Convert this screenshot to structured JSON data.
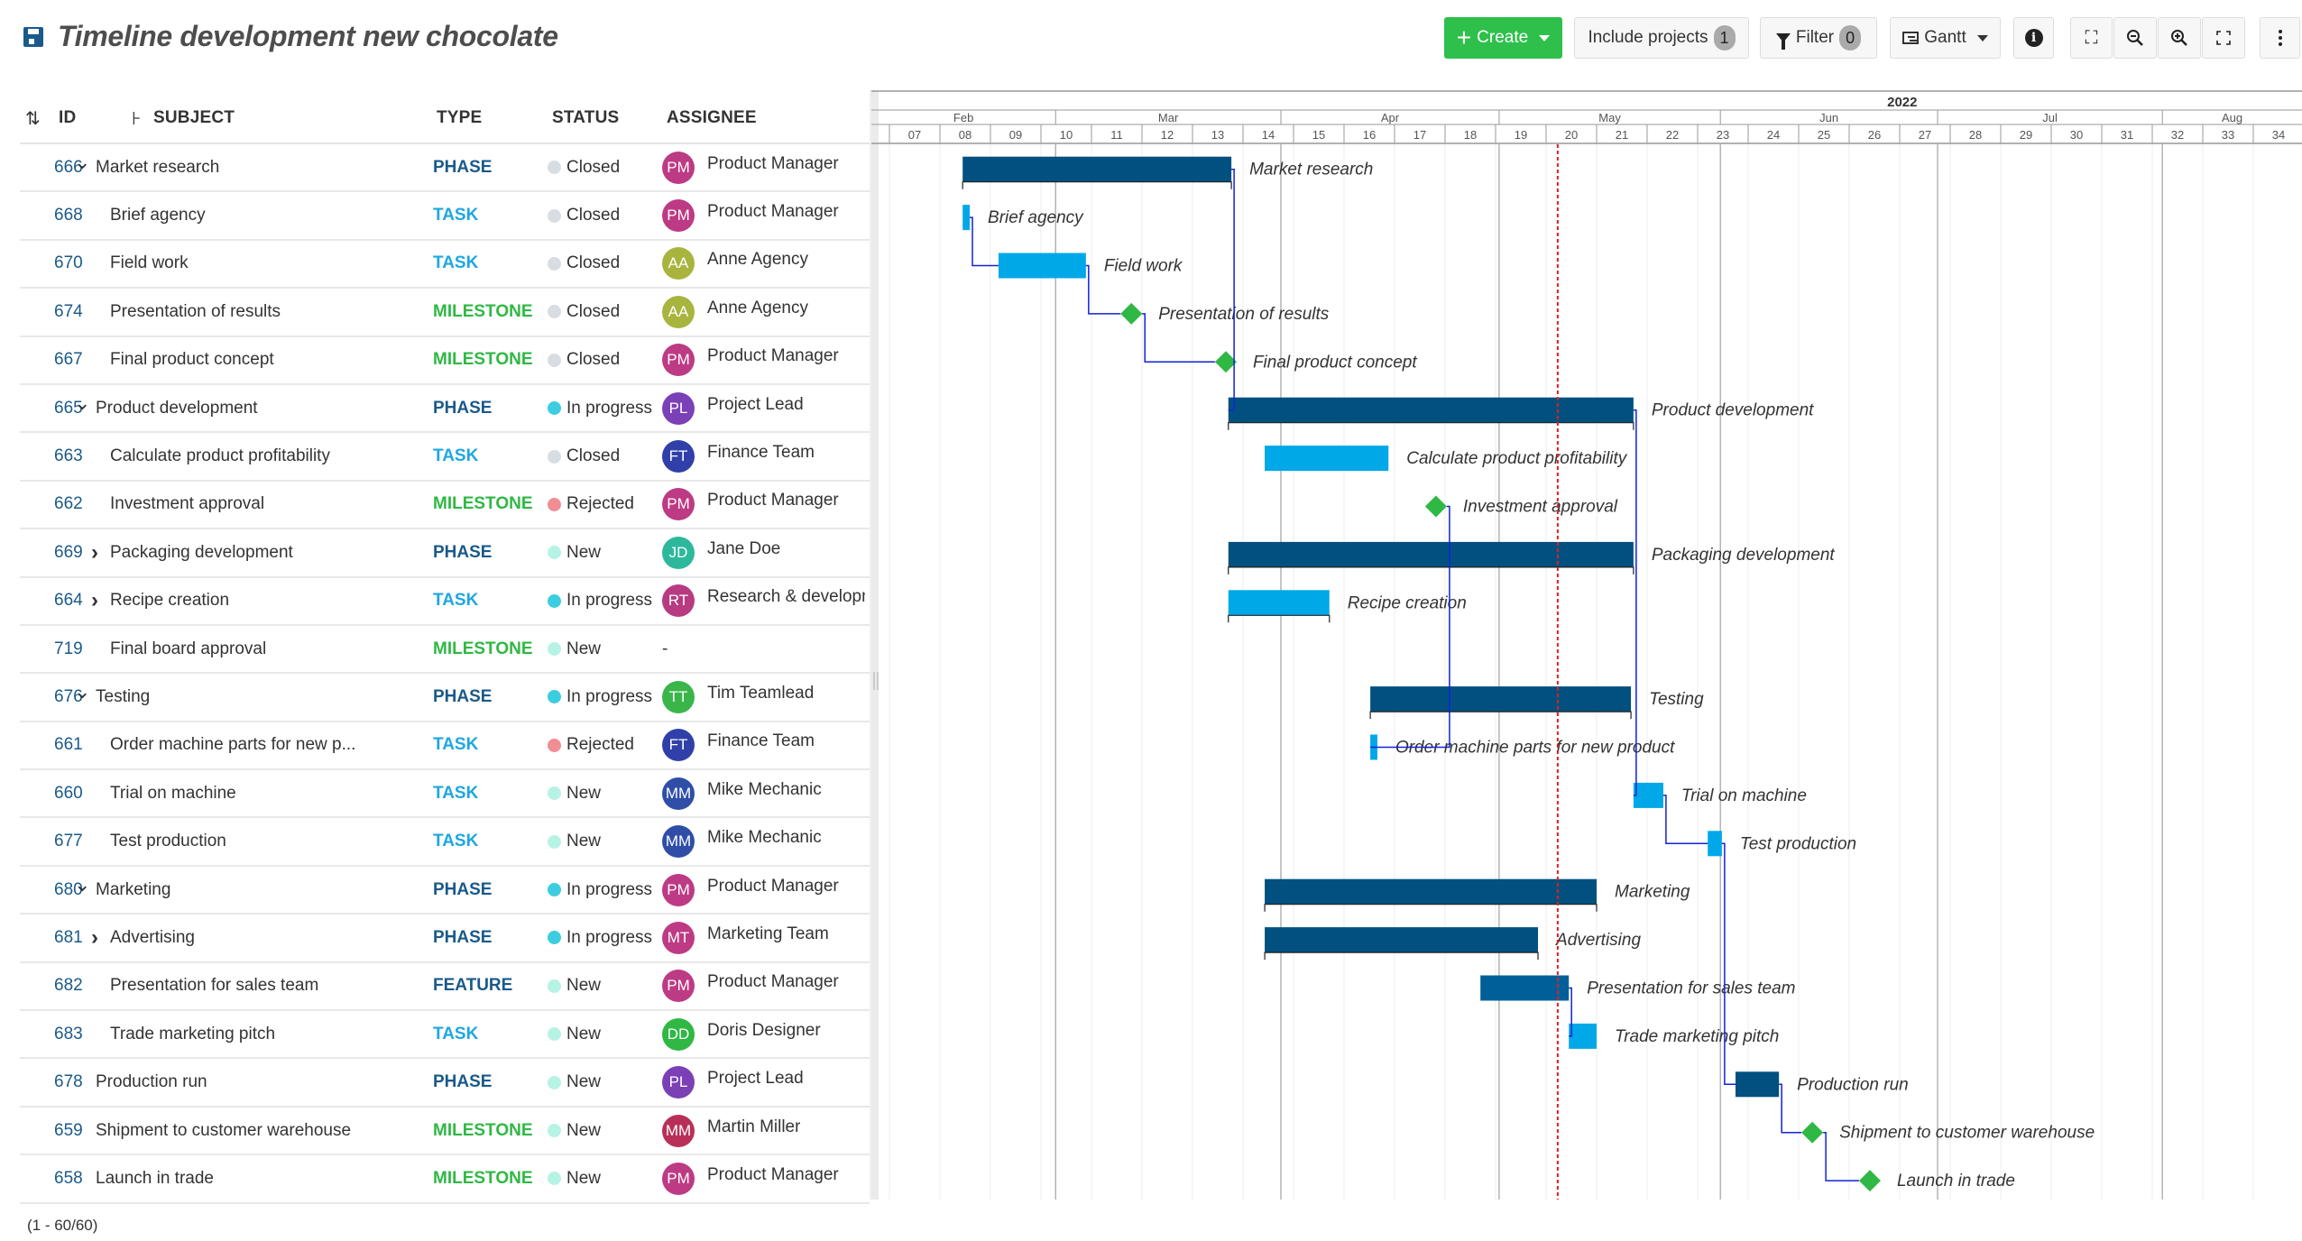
{
  "header": {
    "title": "Timeline development new chocolate",
    "save_icon": "floppy-disk-icon"
  },
  "toolbar": {
    "create_label": "Create",
    "include_projects_label": "Include projects",
    "include_projects_count": "1",
    "filter_label": "Filter",
    "filter_count": "0",
    "view_label": "Gantt",
    "icons": [
      "plus-icon",
      "caret-down-icon",
      "filter-icon",
      "gantt-icon",
      "info-icon",
      "zoom-auto-icon",
      "zoom-out-icon",
      "zoom-in-icon",
      "fullscreen-icon",
      "more-vertical-icon"
    ]
  },
  "table": {
    "columns": {
      "id": "ID",
      "subject": "SUBJECT",
      "type": "TYPE",
      "status": "STATUS",
      "assignee": "ASSIGNEE"
    },
    "footer": "(1 - 60/60)",
    "type_colors": {
      "PHASE": "#1a5a8a",
      "TASK": "#1ea7e1",
      "MILESTONE": "#2fb844",
      "FEATURE": "#1a5a8a"
    },
    "status_colors": {
      "Closed": "#d8dde2",
      "In progress": "#3dcde0",
      "Rejected": "#f08e94",
      "New": "#b6f3e4"
    },
    "rows": [
      {
        "id": "666",
        "subject": "Market research",
        "level": 0,
        "expander": "expanded",
        "type": "PHASE",
        "status": "Closed",
        "initials": "PM",
        "assignee": "Product Manager",
        "avatar_color": "#bd3a84"
      },
      {
        "id": "668",
        "subject": "Brief agency",
        "level": 1,
        "expander": "",
        "type": "TASK",
        "status": "Closed",
        "initials": "PM",
        "assignee": "Product Manager",
        "avatar_color": "#bd3a84"
      },
      {
        "id": "670",
        "subject": "Field work",
        "level": 1,
        "expander": "",
        "type": "TASK",
        "status": "Closed",
        "initials": "AA",
        "assignee": "Anne Agency",
        "avatar_color": "#a9b43e"
      },
      {
        "id": "674",
        "subject": "Presentation of results",
        "level": 1,
        "expander": "",
        "type": "MILESTONE",
        "status": "Closed",
        "initials": "AA",
        "assignee": "Anne Agency",
        "avatar_color": "#a9b43e"
      },
      {
        "id": "667",
        "subject": "Final product concept",
        "level": 1,
        "expander": "",
        "type": "MILESTONE",
        "status": "Closed",
        "initials": "PM",
        "assignee": "Product Manager",
        "avatar_color": "#bd3a84"
      },
      {
        "id": "665",
        "subject": "Product development",
        "level": 0,
        "expander": "expanded",
        "type": "PHASE",
        "status": "In progress",
        "initials": "PL",
        "assignee": "Project Lead",
        "avatar_color": "#7b3fb6"
      },
      {
        "id": "663",
        "subject": "Calculate product profitability",
        "level": 1,
        "expander": "",
        "type": "TASK",
        "status": "Closed",
        "initials": "FT",
        "assignee": "Finance Team",
        "avatar_color": "#3040a8"
      },
      {
        "id": "662",
        "subject": "Investment approval",
        "level": 1,
        "expander": "",
        "type": "MILESTONE",
        "status": "Rejected",
        "initials": "PM",
        "assignee": "Product Manager",
        "avatar_color": "#bd3a84"
      },
      {
        "id": "669",
        "subject": "Packaging development",
        "level": 1,
        "expander": "collapsed",
        "type": "PHASE",
        "status": "New",
        "initials": "JD",
        "assignee": "Jane Doe",
        "avatar_color": "#2db89c"
      },
      {
        "id": "664",
        "subject": "Recipe creation",
        "level": 1,
        "expander": "collapsed",
        "type": "TASK",
        "status": "In progress",
        "initials": "RT",
        "assignee": "Research & developm",
        "avatar_color": "#b83a80"
      },
      {
        "id": "719",
        "subject": "Final board approval",
        "level": 1,
        "expander": "",
        "type": "MILESTONE",
        "status": "New",
        "initials": "",
        "assignee": "-",
        "avatar_color": ""
      },
      {
        "id": "676",
        "subject": "Testing",
        "level": 0,
        "expander": "expanded",
        "type": "PHASE",
        "status": "In progress",
        "initials": "TT",
        "assignee": "Tim Teamlead",
        "avatar_color": "#39b54a"
      },
      {
        "id": "661",
        "subject": "Order machine parts for new p...",
        "level": 1,
        "expander": "",
        "type": "TASK",
        "status": "Rejected",
        "initials": "FT",
        "assignee": "Finance Team",
        "avatar_color": "#3040a8"
      },
      {
        "id": "660",
        "subject": "Trial on machine",
        "level": 1,
        "expander": "",
        "type": "TASK",
        "status": "New",
        "initials": "MM",
        "assignee": "Mike Mechanic",
        "avatar_color": "#2f4ea8"
      },
      {
        "id": "677",
        "subject": "Test production",
        "level": 1,
        "expander": "",
        "type": "TASK",
        "status": "New",
        "initials": "MM",
        "assignee": "Mike Mechanic",
        "avatar_color": "#2f4ea8"
      },
      {
        "id": "680",
        "subject": "Marketing",
        "level": 0,
        "expander": "expanded",
        "type": "PHASE",
        "status": "In progress",
        "initials": "PM",
        "assignee": "Product Manager",
        "avatar_color": "#bd3a84"
      },
      {
        "id": "681",
        "subject": "Advertising",
        "level": 1,
        "expander": "collapsed",
        "type": "PHASE",
        "status": "In progress",
        "initials": "MT",
        "assignee": "Marketing Team",
        "avatar_color": "#bd3a84"
      },
      {
        "id": "682",
        "subject": "Presentation for sales team",
        "level": 1,
        "expander": "",
        "type": "FEATURE",
        "status": "New",
        "initials": "PM",
        "assignee": "Product Manager",
        "avatar_color": "#bd3a84"
      },
      {
        "id": "683",
        "subject": "Trade marketing pitch",
        "level": 1,
        "expander": "",
        "type": "TASK",
        "status": "New",
        "initials": "DD",
        "assignee": "Doris Designer",
        "avatar_color": "#2fb844"
      },
      {
        "id": "678",
        "subject": "Production run",
        "level": 0,
        "expander": "",
        "type": "PHASE",
        "status": "New",
        "initials": "PL",
        "assignee": "Project Lead",
        "avatar_color": "#7b3fb6"
      },
      {
        "id": "659",
        "subject": "Shipment to customer warehouse",
        "level": 0,
        "expander": "",
        "type": "MILESTONE",
        "status": "New",
        "initials": "MM",
        "assignee": "Martin Miller",
        "avatar_color": "#b83058"
      },
      {
        "id": "658",
        "subject": "Launch in trade",
        "level": 0,
        "expander": "",
        "type": "MILESTONE",
        "status": "New",
        "initials": "PM",
        "assignee": "Product Manager",
        "avatar_color": "#bd3a84"
      }
    ]
  },
  "gantt": {
    "year": "2022",
    "weeks": [
      "07",
      "08",
      "09",
      "10",
      "11",
      "12",
      "13",
      "14",
      "15",
      "16",
      "17",
      "18",
      "19",
      "20",
      "21",
      "22",
      "23",
      "24",
      "25",
      "26",
      "27",
      "28",
      "29",
      "30",
      "31",
      "32",
      "33",
      "34"
    ],
    "months": [
      {
        "label": "Feb",
        "start": 6.3,
        "end": 10.29
      },
      {
        "label": "Mar",
        "start": 10.29,
        "end": 14.75
      },
      {
        "label": "Apr",
        "start": 14.75,
        "end": 19.07
      },
      {
        "label": "May",
        "start": 19.07,
        "end": 23.45
      },
      {
        "label": "Jun",
        "start": 23.45,
        "end": 27.75
      },
      {
        "label": "Jul",
        "start": 27.75,
        "end": 32.2
      },
      {
        "label": "Aug",
        "start": 32.2,
        "end": 36.6
      }
    ],
    "today_week": 20.23,
    "colors": {
      "phase": "#02507f",
      "task": "#00a8e8",
      "feature": "#005f99",
      "milestone": "#2fb844",
      "today": "#e02020",
      "relation": "#1222d8"
    },
    "items": [
      {
        "label": "Market research",
        "kind": "phase",
        "start": 8.45,
        "end": 13.77
      },
      {
        "label": "Brief agency",
        "kind": "task",
        "start": 8.45,
        "end": 8.59
      },
      {
        "label": "Field work",
        "kind": "task",
        "start": 9.16,
        "end": 10.89
      },
      {
        "label": "Presentation of results",
        "kind": "milestone",
        "start": 11.79
      },
      {
        "label": "Final product concept",
        "kind": "milestone",
        "start": 13.66
      },
      {
        "label": "Product development",
        "kind": "phase",
        "start": 13.71,
        "end": 21.73
      },
      {
        "label": "Calculate product profitability",
        "kind": "task",
        "start": 14.43,
        "end": 16.88
      },
      {
        "label": "Investment approval",
        "kind": "milestone",
        "start": 17.82
      },
      {
        "label": "Packaging development",
        "kind": "phase",
        "start": 13.71,
        "end": 21.73
      },
      {
        "label": "Recipe creation",
        "kind": "task-bracket",
        "start": 13.71,
        "end": 15.71
      },
      {
        "label": "",
        "kind": "none"
      },
      {
        "label": "Testing",
        "kind": "phase",
        "start": 16.52,
        "end": 21.68
      },
      {
        "label": "Order machine parts for new product",
        "kind": "task",
        "start": 16.52,
        "end": 16.66
      },
      {
        "label": "Trial on machine",
        "kind": "task",
        "start": 21.73,
        "end": 22.32
      },
      {
        "label": "Test production",
        "kind": "task",
        "start": 23.2,
        "end": 23.48
      },
      {
        "label": "Marketing",
        "kind": "phase",
        "start": 14.43,
        "end": 21.0
      },
      {
        "label": "Advertising",
        "kind": "phase",
        "start": 14.43,
        "end": 19.84
      },
      {
        "label": "Presentation for sales team",
        "kind": "feature",
        "start": 18.7,
        "end": 20.45
      },
      {
        "label": "Trade marketing pitch",
        "kind": "task",
        "start": 20.45,
        "end": 21.0
      },
      {
        "label": "Production run",
        "kind": "phase-plain",
        "start": 23.75,
        "end": 24.61
      },
      {
        "label": "Shipment to customer warehouse",
        "kind": "milestone",
        "start": 25.27
      },
      {
        "label": "Launch in trade",
        "kind": "milestone",
        "start": 26.41
      }
    ],
    "relations": [
      {
        "from": 1,
        "to": 2
      },
      {
        "from": 2,
        "to": 3
      },
      {
        "from": 3,
        "to": 4
      },
      {
        "from": 0,
        "to": 5
      },
      {
        "from": 7,
        "to": 12
      },
      {
        "from": 5,
        "to": 13
      },
      {
        "from": 13,
        "to": 14
      },
      {
        "from": 14,
        "to": 19
      },
      {
        "from": 17,
        "to": 18
      },
      {
        "from": 19,
        "to": 20
      },
      {
        "from": 20,
        "to": 21
      }
    ]
  }
}
